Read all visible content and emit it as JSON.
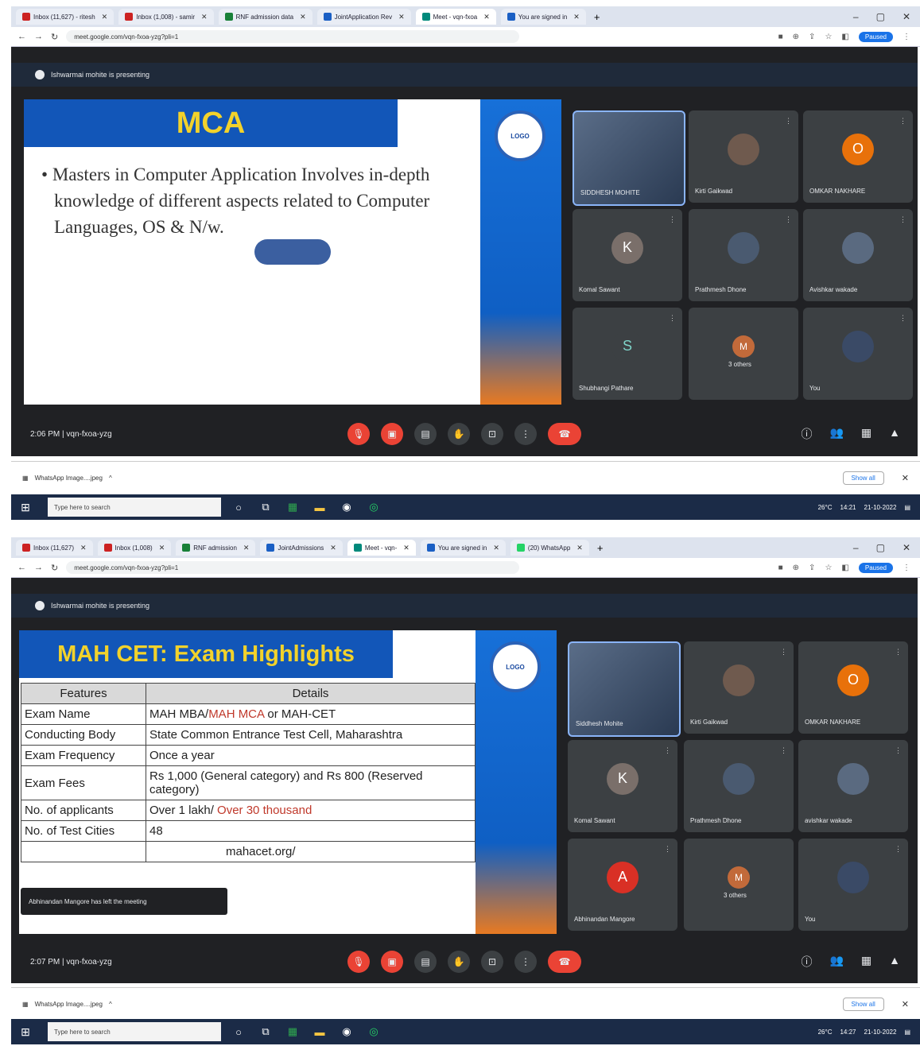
{
  "browser": {
    "tabs1": [
      {
        "label": "Inbox (11,627) - ritesh",
        "active": false
      },
      {
        "label": "Inbox (1,008) - samir",
        "active": false
      },
      {
        "label": "RNF admission data",
        "active": false
      },
      {
        "label": "JointApplication Rev",
        "active": false
      },
      {
        "label": "Meet - vqn-fxoa",
        "active": true
      },
      {
        "label": "You are signed in",
        "active": false
      }
    ],
    "tabs2": [
      {
        "label": "Inbox (11,627)",
        "active": false
      },
      {
        "label": "Inbox (1,008)",
        "active": false
      },
      {
        "label": "RNF admission",
        "active": false
      },
      {
        "label": "JointAdmissions",
        "active": false
      },
      {
        "label": "Meet - vqn-",
        "active": true
      },
      {
        "label": "You are signed in",
        "active": false
      },
      {
        "label": "(20) WhatsApp",
        "active": false
      }
    ],
    "url": "meet.google.com/vqn-fxoa-yzg?pli=1",
    "profile_label": "Paused",
    "plus": "+",
    "win_min": "–",
    "win_max": "▢",
    "win_close": "✕"
  },
  "meet1": {
    "presenting": "Ishwarmai mohite is presenting",
    "slide_title": "MCA",
    "bullet": "Masters in Computer Application Involves in-depth knowledge of different aspects related to Computer Languages, OS & N/w.",
    "participants": [
      {
        "name": "SIDDHESH MOHITE",
        "initial": "",
        "color": "",
        "video": true
      },
      {
        "name": "Kirti Gaikwad",
        "initial": "",
        "color": "#6f5a4e",
        "video": false
      },
      {
        "name": "OMKAR NAKHARE",
        "initial": "O",
        "color": "#e8710a",
        "video": false
      },
      {
        "name": "Komal Sawant",
        "initial": "K",
        "color": "#7a6f6a",
        "video": false
      },
      {
        "name": "Prathmesh Dhone",
        "initial": "",
        "color": "#4a5a70",
        "video": false
      },
      {
        "name": "Avishkar wakade",
        "initial": "",
        "color": "#5a6a80",
        "video": false
      },
      {
        "name": "Shubhangi Pathare",
        "initial": "S",
        "color": "#1e6f6a",
        "video": false
      },
      {
        "name": "3 others",
        "initial": "M",
        "color": "#c26a3a",
        "video": false
      },
      {
        "name": "You",
        "initial": "",
        "color": "#3a4a66",
        "video": false
      }
    ],
    "time": "2:06 PM | vqn-fxoa-yzg"
  },
  "meet2": {
    "presenting": "Ishwarmai mohite is presenting",
    "slide_title": "MAH CET: Exam Highlights",
    "table_headers": [
      "Features",
      "Details"
    ],
    "table_rows": [
      {
        "feature": "Exam Name",
        "detail_a": "MAH MBA/",
        "detail_red": "MAH MCA",
        "detail_b": " or MAH-CET"
      },
      {
        "feature": "Conducting Body",
        "detail_a": "State Common Entrance Test Cell, Maharashtra",
        "detail_red": "",
        "detail_b": ""
      },
      {
        "feature": "Exam Frequency",
        "detail_a": "Once a year",
        "detail_red": "",
        "detail_b": ""
      },
      {
        "feature": "Exam Fees",
        "detail_a": "Rs 1,000 (General category) and Rs 800 (Reserved category)",
        "detail_red": "",
        "detail_b": ""
      },
      {
        "feature": "No. of applicants",
        "detail_a": "Over 1 lakh/ ",
        "detail_red": "Over 30 thousand",
        "detail_b": ""
      },
      {
        "feature": "No. of Test Cities",
        "detail_a": "48",
        "detail_red": "",
        "detail_b": ""
      },
      {
        "feature": "",
        "detail_a": "mahacet.org/",
        "detail_red": "",
        "detail_b": ""
      }
    ],
    "toast": "Abhinandan Mangore has left the meeting",
    "participants": [
      {
        "name": "Siddhesh Mohite",
        "initial": "",
        "color": "",
        "video": true
      },
      {
        "name": "Kirti Gaikwad",
        "initial": "",
        "color": "#6f5a4e",
        "video": false
      },
      {
        "name": "OMKAR NAKHARE",
        "initial": "O",
        "color": "#e8710a",
        "video": false
      },
      {
        "name": "Komal Sawant",
        "initial": "K",
        "color": "#7a6f6a",
        "video": false
      },
      {
        "name": "Prathmesh Dhone",
        "initial": "",
        "color": "#4a5a70",
        "video": false
      },
      {
        "name": "avishkar wakade",
        "initial": "",
        "color": "#5a6a80",
        "video": false
      },
      {
        "name": "Abhinandan Mangore",
        "initial": "A",
        "color": "#d93025",
        "video": false
      },
      {
        "name": "3 others",
        "initial": "M",
        "color": "#c26a3a",
        "video": false
      },
      {
        "name": "You",
        "initial": "",
        "color": "#3a4a66",
        "video": false
      }
    ],
    "time": "2:07 PM | vqn-fxoa-yzg"
  },
  "download": {
    "file": "WhatsApp Image....jpeg",
    "show_all": "Show all"
  },
  "taskbar": {
    "search": "Type here to search",
    "weather": "26°C",
    "time1": "14:21",
    "date1": "21-10-2022",
    "time2": "14:27",
    "date2": "21-10-2022"
  },
  "colors": {
    "accent": "#1a73e8",
    "slide_blue": "#1256b8",
    "slide_yellow": "#f2d22b",
    "end_red": "#ea4335"
  }
}
